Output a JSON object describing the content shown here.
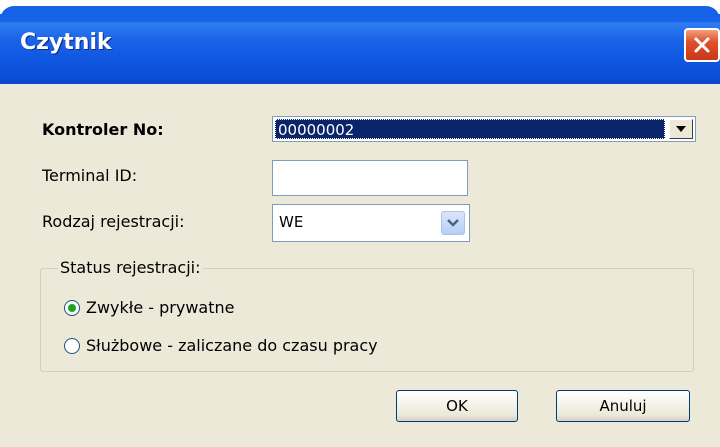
{
  "window": {
    "title": "Czytnik"
  },
  "form": {
    "controller_label": "Kontroler No:",
    "controller_value": "00000002",
    "terminal_label": "Terminal ID:",
    "terminal_value": "",
    "registration_type_label": "Rodzaj rejestracji:",
    "registration_type_value": "WE"
  },
  "status_group": {
    "legend": "Status rejestracji:",
    "options": [
      {
        "label": "Zwykłe - prywatne",
        "checked": true
      },
      {
        "label": "Służbowe - zaliczane do czasu pracy",
        "checked": false
      }
    ]
  },
  "buttons": {
    "ok": "OK",
    "cancel": "Anuluj"
  },
  "colors": {
    "titlebar": "#0a5de6",
    "selection": "#0a246a",
    "dialog_bg": "#ece9d8",
    "close": "#e0502a"
  }
}
